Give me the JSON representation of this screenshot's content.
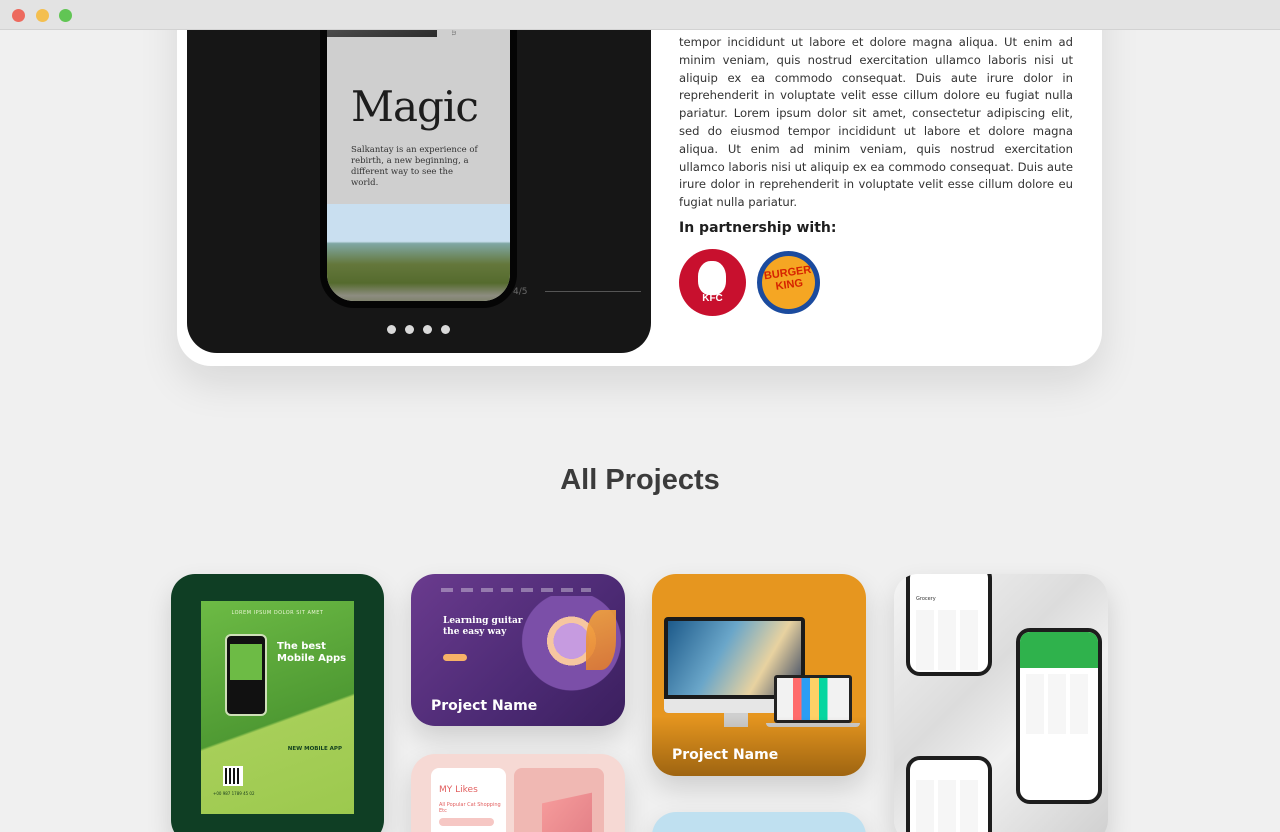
{
  "window": {
    "controls": [
      "close",
      "minimize",
      "maximize"
    ]
  },
  "case_study": {
    "phone": {
      "side_text": "Urban",
      "title": "Magic",
      "subtitle": "Salkantay is an experience of rebirth, a new beginning, a different way to see the world."
    },
    "slide_counter": "4/5",
    "dots": 4,
    "description": "tempor incididunt ut labore et dolore magna aliqua. Ut enim ad minim veniam, quis nostrud exercitation ullamco laboris nisi ut aliquip ex ea commodo consequat. Duis aute irure dolor in reprehenderit in voluptate velit esse cillum dolore eu fugiat nulla pariatur. Lorem ipsum dolor sit amet, consectetur adipiscing elit, sed do eiusmod tempor incididunt ut labore et dolore magna aliqua. Ut enim ad minim veniam, quis nostrud exercitation ullamco laboris nisi ut aliquip ex ea commodo consequat. Duis aute irure dolor in reprehenderit in voluptate velit esse cillum dolore eu fugiat nulla pariatur.",
    "partnership_title": "In partnership with:",
    "partners": [
      {
        "name": "KFC",
        "text": "KFC"
      },
      {
        "name": "Burger King",
        "text": "BURGER KING"
      }
    ]
  },
  "projects": {
    "title": "All Projects",
    "cards": [
      {
        "top_text": "LOREM IPSUM DOLOR SIT AMET",
        "headline": "The best Mobile Apps",
        "badge": "NEW MOBILE APP",
        "footer": "+00 987 1789 45 02"
      },
      {
        "headline": "Learning guitar the easy way",
        "label": "Project Name"
      },
      {
        "title": "MY Likes",
        "tabs": "All   Popular   Cat   Shopping   Etc"
      },
      {
        "label": "Project Name"
      },
      {},
      {
        "header_text": "Grocery"
      }
    ]
  },
  "colors": {
    "page_bg": "#f0f0f0",
    "card_bg": "#ffffff",
    "showcase_bg": "#161616",
    "kfc_red": "#c8102e",
    "bk_blue": "#1b4b9e",
    "bk_orange": "#f5a623",
    "mobile_green": "#0f3e24",
    "guitar_purple": "#4c2a74",
    "mac_orange": "#e6961f",
    "grocery_green": "#2fb24c"
  }
}
